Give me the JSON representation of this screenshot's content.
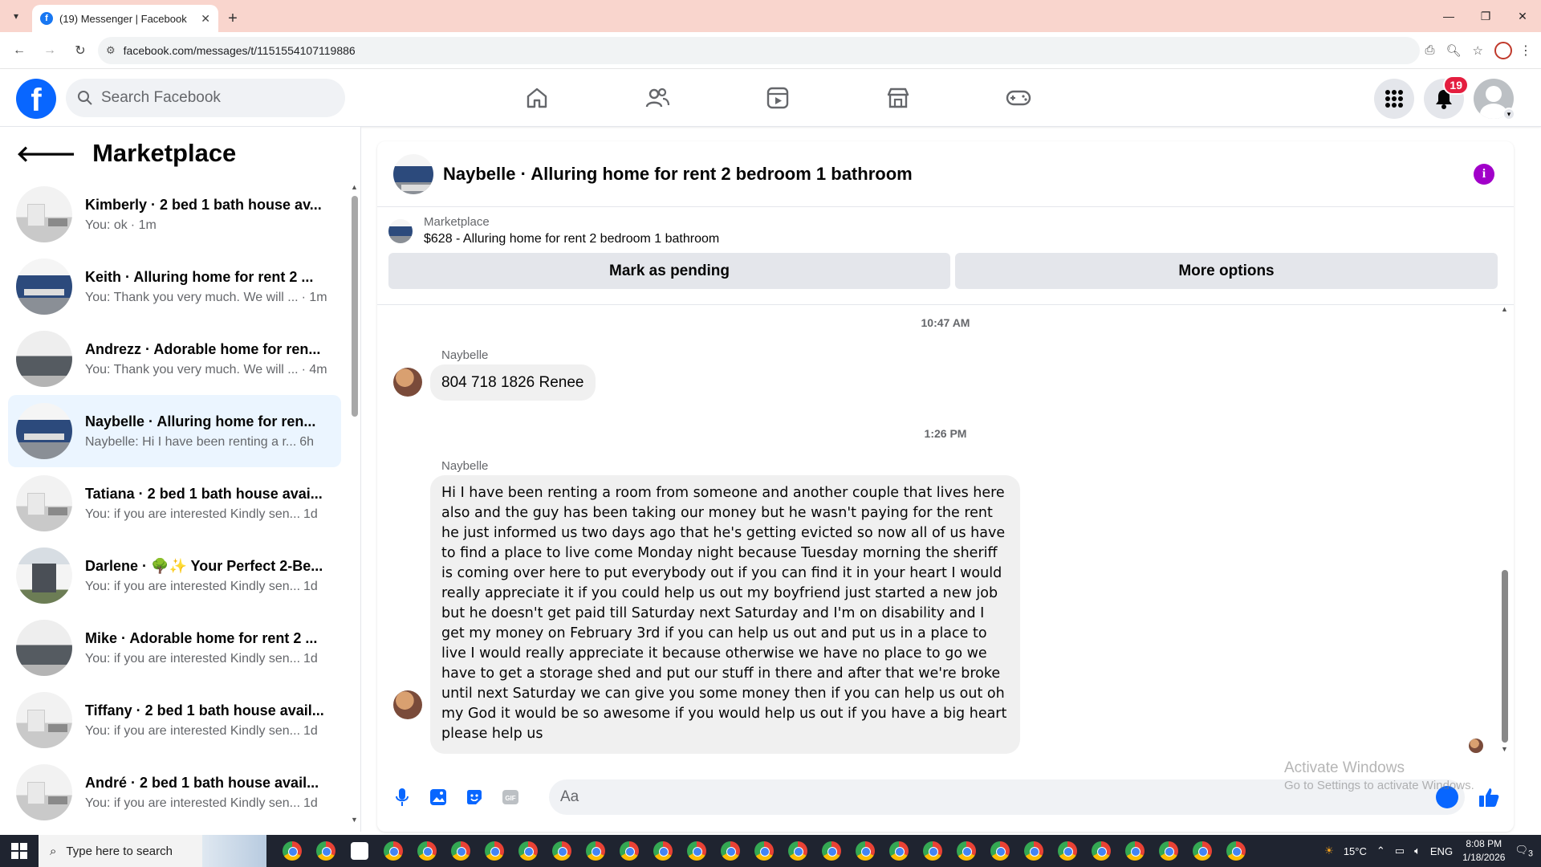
{
  "browser": {
    "tab_title": "(19) Messenger | Facebook",
    "url": "facebook.com/messages/t/1151554107119886"
  },
  "header": {
    "search_placeholder": "Search Facebook",
    "notification_count": "19"
  },
  "left_panel": {
    "title": "Marketplace",
    "conversations": [
      {
        "title": "Kimberly · 2 bed 1 bath house av...",
        "preview": "You: ok",
        "time": "· 1m",
        "thumb": "white"
      },
      {
        "title": "Keith · Alluring home for rent 2 ...",
        "preview": "You: Thank you very much. We will ...",
        "time": "· 1m",
        "thumb": "blue"
      },
      {
        "title": "Andrezz · Adorable home for ren...",
        "preview": "You: Thank you very much. We will ...",
        "time": "· 4m",
        "thumb": "gray"
      },
      {
        "title": "Naybelle · Alluring home for ren...",
        "preview": "Naybelle: Hi I have been renting a r...",
        "time": "6h",
        "thumb": "blue",
        "active": true
      },
      {
        "title": "Tatiana · 2 bed 1 bath house avai...",
        "preview": "You: if you are interested Kindly sen...",
        "time": "1d",
        "thumb": "white"
      },
      {
        "title": "Darlene · 🌳✨ Your Perfect 2-Be...",
        "preview": "You: if you are interested Kindly sen...",
        "time": "1d",
        "thumb": "town"
      },
      {
        "title": "Mike · Adorable home for rent 2 ...",
        "preview": "You: if you are interested Kindly sen...",
        "time": "1d",
        "thumb": "gray"
      },
      {
        "title": "Tiffany · 2 bed 1 bath house avail...",
        "preview": "You: if you are interested Kindly sen...",
        "time": "1d",
        "thumb": "white"
      },
      {
        "title": "André · 2 bed 1 bath house avail...",
        "preview": "You: if you are interested Kindly sen...",
        "time": "1d",
        "thumb": "white"
      }
    ]
  },
  "chat": {
    "title": "Naybelle · Alluring home for rent 2 bedroom 1 bathroom",
    "marketplace_label": "Marketplace",
    "listing": "$628 - Alluring home for rent 2 bedroom 1 bathroom",
    "mark_pending": "Mark as pending",
    "more_options": "More options",
    "messages": [
      {
        "timestamp": "10:47 AM",
        "sender": "Naybelle",
        "text": "804 718 1826 Renee"
      },
      {
        "timestamp": "1:26 PM",
        "sender": "Naybelle",
        "text": "Hi I have been renting a room from someone and another couple that lives here also and the guy has been taking our money but he wasn't paying for the rent he just informed us two days ago that he's getting evicted so now all of us have to find a place to live come Monday night because Tuesday morning the sheriff is coming over here to put everybody out if you can find it in your heart I would really appreciate it if you could help us out my boyfriend just started a new job but he doesn't get paid till Saturday next Saturday and I'm on disability and I get my money on February 3rd if you can help us out and put us in a place to live I would really appreciate it because otherwise we have no place to go we have to get a storage shed and put our stuff in there and after that we're broke until next Saturday we can give you some money then if you can help us out oh my God it would be so awesome if you would help us out if you have a big heart please help us"
      }
    ],
    "composer_placeholder": "Aa"
  },
  "watermark": {
    "line1": "Activate Windows",
    "line2": "Go to Settings to activate Windows."
  },
  "taskbar": {
    "search_placeholder": "Type here to search",
    "temperature": "15°C",
    "language": "ENG",
    "time": "8:08 PM",
    "date": "1/18/2026",
    "notif_count": "3"
  },
  "colors": {
    "fb_blue": "#0866ff",
    "tab_bar": "#f9d5cd",
    "active_conv": "#ebf5ff",
    "badge_red": "#e41e3f",
    "info_purple": "#a100c9"
  }
}
